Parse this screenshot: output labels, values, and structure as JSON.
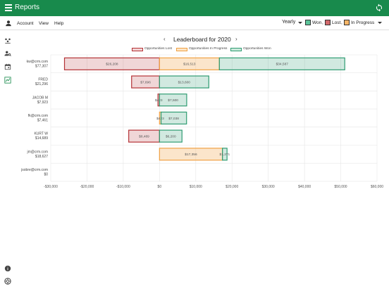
{
  "app": {
    "title": "Reports"
  },
  "menu": {
    "account": "Account",
    "view": "View",
    "help": "Help"
  },
  "filters": {
    "period": "Yearly",
    "won": "Won",
    "lost": "Lost",
    "in_progress": "In Progress",
    "sep1": ",",
    "sep2": ","
  },
  "chart_data": {
    "type": "bar",
    "title": "Leaderboard for 2020",
    "legend": [
      "Opportunities Lost",
      "Opportunities In Progress",
      "Opportunities Won"
    ],
    "colors": {
      "lost": "#b43236",
      "in_progress": "#f0a143",
      "won": "#2f9c72"
    },
    "xlim": [
      -30000,
      60000
    ],
    "x_ticks": [
      "-$30,000",
      "-$20,000",
      "-$10,000",
      "$0",
      "$10,000",
      "$20,000",
      "$30,000",
      "$40,000",
      "$50,000",
      "$60,000"
    ],
    "rows": [
      {
        "name": "kw@crm.com",
        "total": "$77,307",
        "lost": -26208,
        "in_progress": 16513,
        "won": 34587,
        "lost_label": "$26,208",
        "in_progress_label": "$16,513",
        "won_label": "$34,587"
      },
      {
        "name": "FRED",
        "total": "$21,296",
        "lost": -7696,
        "in_progress": 0,
        "won": 13600,
        "lost_label": "$7,696",
        "in_progress_label": "",
        "won_label": "$13,600"
      },
      {
        "name": "JACOB M",
        "total": "$7,923",
        "lost": -423,
        "in_progress": 0,
        "won": 7500,
        "lost_label": "$423",
        "in_progress_label": "",
        "won_label": "$7,500"
      },
      {
        "name": "fk@crm.com",
        "total": "$7,461",
        "lost": 0,
        "in_progress": 423,
        "won": 7038,
        "lost_label": "",
        "in_progress_label": "$423",
        "won_label": "$7,038"
      },
      {
        "name": "KURT W",
        "total": "$14,689",
        "lost": -8489,
        "in_progress": 0,
        "won": 6200,
        "lost_label": "$8,489",
        "in_progress_label": "",
        "won_label": "$6,200"
      },
      {
        "name": "jm@crm.com",
        "total": "$18,627",
        "lost": 0,
        "in_progress": 17356,
        "won": 1271,
        "lost_label": "",
        "in_progress_label": "$17,356",
        "won_label": "$1,271"
      },
      {
        "name": "jsobre@crm.com",
        "total": "$0",
        "lost": 0,
        "in_progress": 0,
        "won": 0,
        "lost_label": "",
        "in_progress_label": "",
        "won_label": ""
      }
    ]
  }
}
